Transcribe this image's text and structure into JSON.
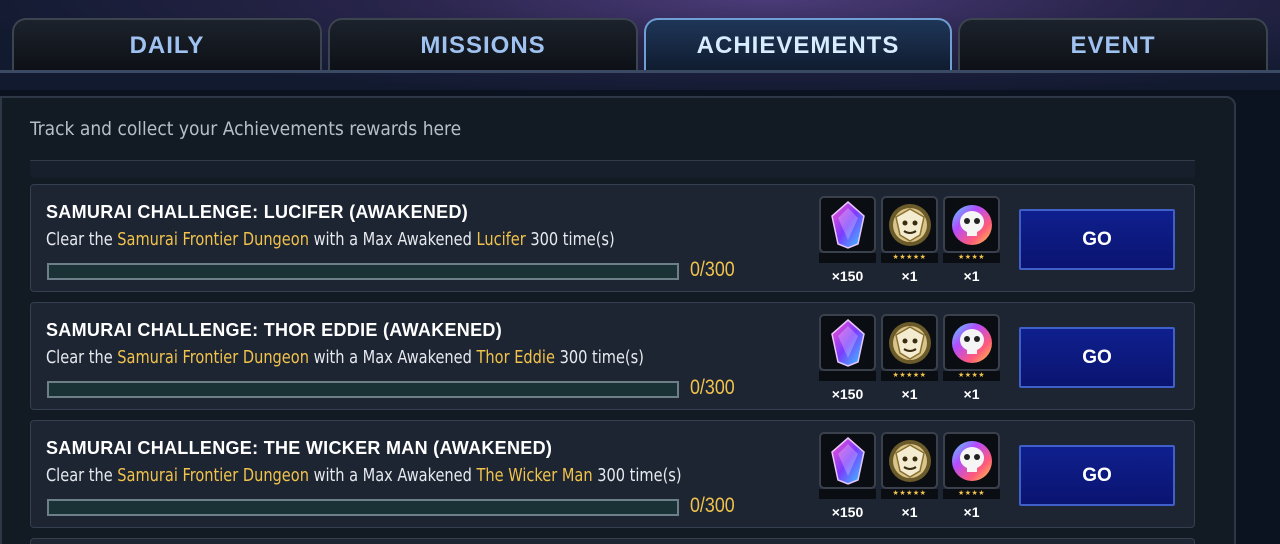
{
  "tabs": [
    {
      "label": "DAILY",
      "active": false
    },
    {
      "label": "MISSIONS",
      "active": false
    },
    {
      "label": "ACHIEVEMENTS",
      "active": true
    },
    {
      "label": "EVENT",
      "active": false
    }
  ],
  "subtitle": "Track and collect your Achievements rewards here",
  "colors": {
    "highlight": "#f1c24c",
    "go_button": "#0f1f8e",
    "active_tab_border": "#6f9fd3"
  },
  "achievements": [
    {
      "title": "SAMURAI CHALLENGE: LUCIFER (AWAKENED)",
      "desc_pre": "Clear the ",
      "dungeon": "Samurai Frontier Dungeon",
      "desc_mid": " with a Max Awakened ",
      "hero": "Lucifer",
      "desc_post": " 300 time(s)",
      "progress_text": "0/300",
      "progress_fraction": 0,
      "rewards": [
        {
          "icon": "crystal-gem-icon",
          "stars": "",
          "qty": "×150"
        },
        {
          "icon": "gold-lion-token-icon",
          "stars": "★★★★★",
          "qty": "×1"
        },
        {
          "icon": "rainbow-skull-token-icon",
          "stars": "★★★★",
          "qty": "×1"
        }
      ],
      "go_label": "GO"
    },
    {
      "title": "SAMURAI CHALLENGE: THOR EDDIE (AWAKENED)",
      "desc_pre": "Clear the ",
      "dungeon": "Samurai Frontier Dungeon",
      "desc_mid": " with a Max Awakened ",
      "hero": "Thor Eddie",
      "desc_post": " 300 time(s)",
      "progress_text": "0/300",
      "progress_fraction": 0,
      "rewards": [
        {
          "icon": "crystal-gem-icon",
          "stars": "",
          "qty": "×150"
        },
        {
          "icon": "gold-lion-token-icon",
          "stars": "★★★★★",
          "qty": "×1"
        },
        {
          "icon": "rainbow-skull-token-icon",
          "stars": "★★★★",
          "qty": "×1"
        }
      ],
      "go_label": "GO"
    },
    {
      "title": "SAMURAI CHALLENGE: THE WICKER MAN (AWAKENED)",
      "desc_pre": "Clear the ",
      "dungeon": "Samurai Frontier Dungeon",
      "desc_mid": " with a Max Awakened ",
      "hero": "The Wicker Man",
      "desc_post": " 300 time(s)",
      "progress_text": "0/300",
      "progress_fraction": 0,
      "rewards": [
        {
          "icon": "crystal-gem-icon",
          "stars": "",
          "qty": "×150"
        },
        {
          "icon": "gold-lion-token-icon",
          "stars": "★★★★★",
          "qty": "×1"
        },
        {
          "icon": "rainbow-skull-token-icon",
          "stars": "★★★★",
          "qty": "×1"
        }
      ],
      "go_label": "GO"
    }
  ]
}
